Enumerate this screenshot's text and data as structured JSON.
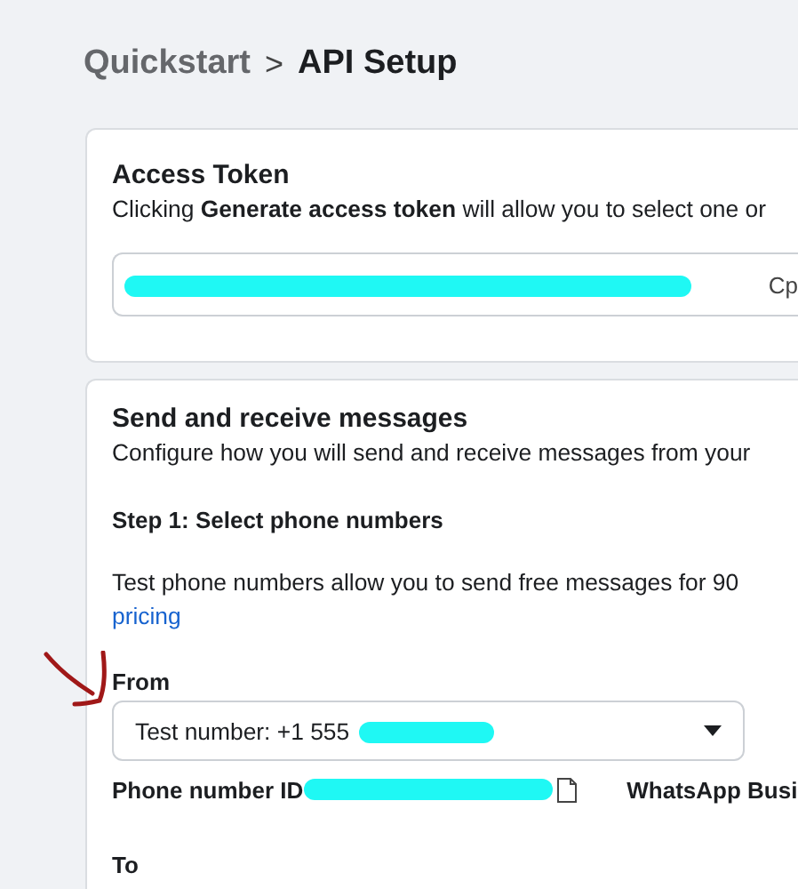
{
  "breadcrumb": {
    "parent": "Quickstart",
    "separator": ">",
    "current": "API Setup"
  },
  "access_token": {
    "title": "Access Token",
    "description": "Clicking **Generate access token** will allow you to select one or",
    "token_visible": "Cp"
  },
  "messages": {
    "title": "Send and receive messages",
    "description": "Configure how you will send and receive messages from your",
    "step": "Step 1: Select phone numbers",
    "info": "Test phone numbers allow you to send free messages for 90",
    "link": "pricing",
    "from_label": "From",
    "from_value": "Test number: +1 555",
    "phone_id_label": "Phone number ID",
    "account_label": "WhatsApp Busi",
    "to_label": "To"
  }
}
